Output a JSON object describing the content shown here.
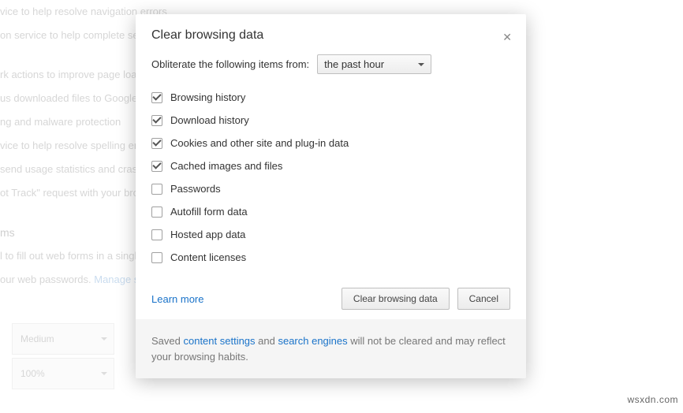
{
  "background": {
    "lines": [
      "vice to help resolve navigation errors",
      "on service to help complete sea",
      "rk actions to improve page load",
      "us downloaded files to Google",
      "ng and malware protection",
      "vice to help resolve spelling erro",
      " send usage statistics and crash",
      "ot Track\" request with your brow"
    ],
    "section_heading": "ms",
    "forms_line_prefix": "l to fill out web forms in a singl",
    "passwords_line_prefix": "our web passwords.  ",
    "passwords_link": "Manage s",
    "dropdown1": "Medium",
    "dropdown2": "100%"
  },
  "dialog": {
    "title": "Clear browsing data",
    "close_glyph": "✕",
    "obliterate_label": "Obliterate the following items from:",
    "time_range": "the past hour",
    "items": [
      {
        "label": "Browsing history",
        "checked": true
      },
      {
        "label": "Download history",
        "checked": true
      },
      {
        "label": "Cookies and other site and plug-in data",
        "checked": true
      },
      {
        "label": "Cached images and files",
        "checked": true
      },
      {
        "label": "Passwords",
        "checked": false
      },
      {
        "label": "Autofill form data",
        "checked": false
      },
      {
        "label": "Hosted app data",
        "checked": false
      },
      {
        "label": "Content licenses",
        "checked": false
      }
    ],
    "learn_more": "Learn more",
    "clear_button": "Clear browsing data",
    "cancel_button": "Cancel",
    "footer_prefix": "Saved ",
    "footer_link1": "content settings",
    "footer_mid": " and ",
    "footer_link2": "search engines",
    "footer_suffix": " will not be cleared and may reflect your browsing habits."
  },
  "watermark": "wsxdn.com"
}
